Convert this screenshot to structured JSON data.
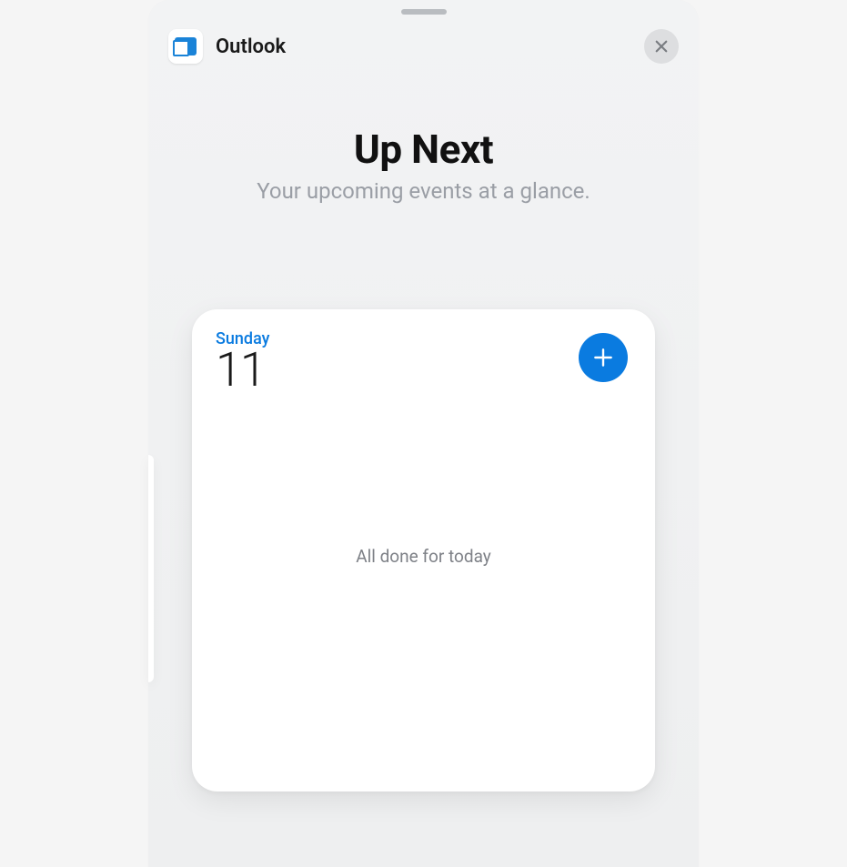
{
  "header": {
    "app_name": "Outlook",
    "close_icon": "close"
  },
  "hero": {
    "title": "Up Next",
    "subtitle": "Your upcoming events at a glance."
  },
  "widget": {
    "day_name": "Sunday",
    "day_number": "11",
    "add_icon": "plus",
    "message": "All done for today"
  },
  "colors": {
    "accent": "#0a7be0"
  }
}
